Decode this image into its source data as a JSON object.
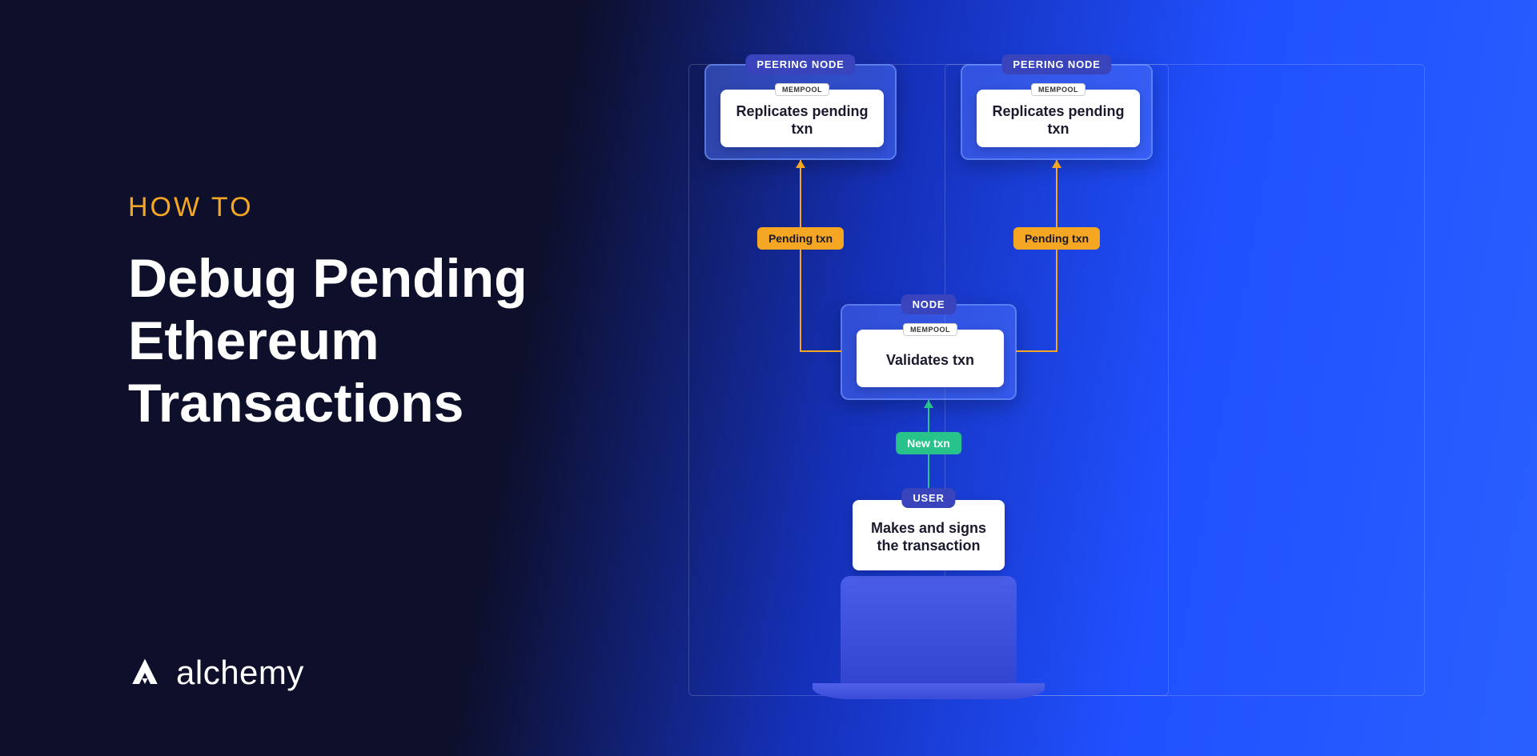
{
  "eyebrow": "HOW TO",
  "title": "Debug Pending Ethereum Transactions",
  "brand": "alchemy",
  "diagram": {
    "peering_left": {
      "badge": "PEERING NODE",
      "mempool": "MEMPOOL",
      "text": "Replicates pending txn"
    },
    "peering_right": {
      "badge": "PEERING NODE",
      "mempool": "MEMPOOL",
      "text": "Replicates pending txn"
    },
    "node": {
      "badge": "NODE",
      "mempool": "MEMPOOL",
      "text": "Validates txn"
    },
    "user": {
      "badge": "USER",
      "text": "Makes and signs the transaction"
    },
    "pill_pending_left": "Pending txn",
    "pill_pending_right": "Pending txn",
    "pill_new": "New txn"
  }
}
